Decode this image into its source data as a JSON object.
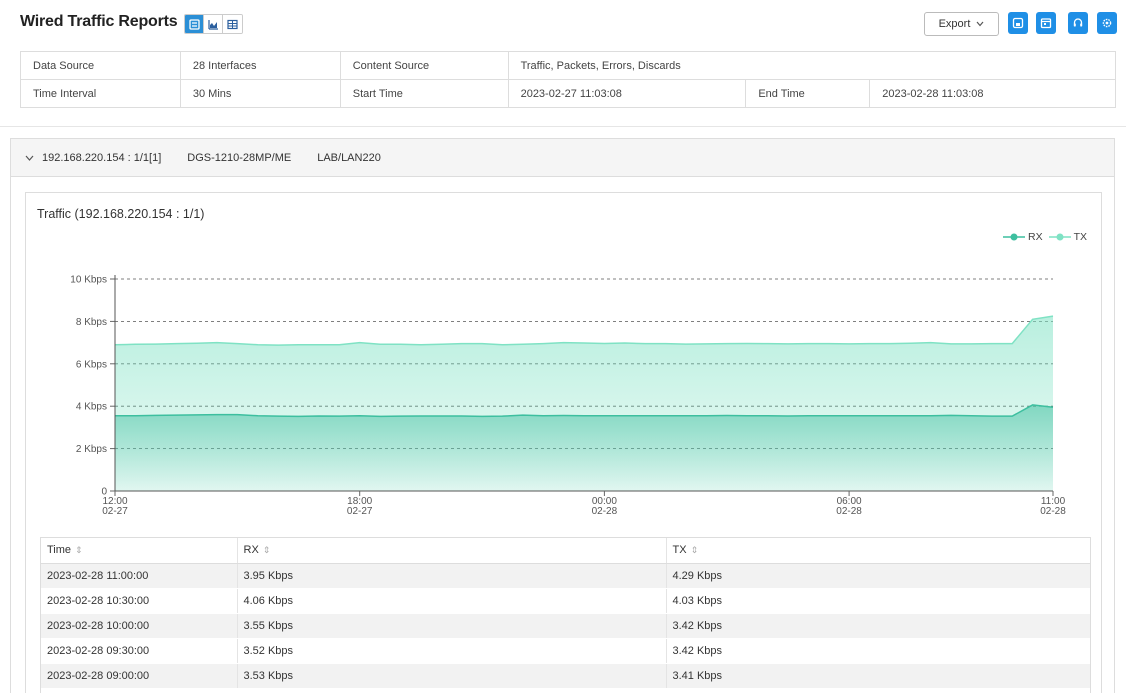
{
  "header": {
    "title": "Wired Traffic Reports",
    "export_label": "Export"
  },
  "info": {
    "row1": [
      {
        "label": "Data Source",
        "value": "28 Interfaces"
      },
      {
        "label": "Content Source",
        "value": "Traffic, Packets, Errors, Discards"
      }
    ],
    "row2": [
      {
        "label": "Time Interval",
        "value": "30 Mins"
      },
      {
        "label": "Start Time",
        "value": "2023-02-27 11:03:08"
      },
      {
        "label": "End Time",
        "value": "2023-02-28 11:03:08"
      }
    ]
  },
  "panel": {
    "ip_port": "192.168.220.154 : 1/1[1]",
    "model": "DGS-1210-28MP/ME",
    "location": "LAB/LAN220"
  },
  "chart_title": "Traffic (192.168.220.154 : 1/1)",
  "colors": {
    "rx": "#3dbf9f",
    "tx": "#7fe2c4",
    "accent": "#1f8fe6"
  },
  "chart_data": {
    "type": "area",
    "title": "Traffic (192.168.220.154 : 1/1)",
    "ylabel": "",
    "xlabel": "",
    "ylim": [
      0,
      10
    ],
    "y_unit": "Kbps",
    "y_ticks": [
      "0",
      "2 Kbps",
      "4 Kbps",
      "6 Kbps",
      "8 Kbps",
      "10 Kbps"
    ],
    "x_ticks": [
      {
        "time": "12:00",
        "date": "02-27"
      },
      {
        "time": "18:00",
        "date": "02-27"
      },
      {
        "time": "00:00",
        "date": "02-28"
      },
      {
        "time": "06:00",
        "date": "02-28"
      },
      {
        "time": "11:00",
        "date": "02-28"
      }
    ],
    "x_range_hours": [
      0,
      23
    ],
    "legend_position": "top-right",
    "grid": "horizontal dashed",
    "series": [
      {
        "name": "RX",
        "values": [
          3.55,
          3.55,
          3.57,
          3.58,
          3.59,
          3.6,
          3.6,
          3.55,
          3.53,
          3.52,
          3.54,
          3.53,
          3.55,
          3.52,
          3.53,
          3.54,
          3.54,
          3.54,
          3.52,
          3.53,
          3.58,
          3.55,
          3.56,
          3.55,
          3.55,
          3.55,
          3.55,
          3.55,
          3.55,
          3.55,
          3.56,
          3.55,
          3.55,
          3.54,
          3.55,
          3.55,
          3.55,
          3.55,
          3.55,
          3.55,
          3.55,
          3.57,
          3.55,
          3.53,
          3.53,
          4.06,
          3.95
        ]
      },
      {
        "name": "TX",
        "values": [
          6.9,
          6.92,
          6.93,
          6.95,
          6.97,
          7.0,
          6.95,
          6.9,
          6.88,
          6.9,
          6.9,
          6.9,
          7.0,
          6.92,
          6.92,
          6.9,
          6.92,
          6.95,
          6.95,
          6.9,
          6.92,
          6.95,
          7.0,
          6.98,
          6.96,
          6.98,
          6.95,
          6.95,
          6.93,
          6.94,
          6.95,
          6.96,
          6.95,
          6.94,
          6.95,
          6.95,
          6.94,
          6.95,
          6.95,
          6.97,
          7.0,
          6.94,
          6.94,
          6.95,
          6.95,
          8.1,
          8.25
        ]
      }
    ]
  },
  "table": {
    "headers": [
      "Time",
      "RX",
      "TX"
    ],
    "rows": [
      [
        "2023-02-28 11:00:00",
        "3.95 Kbps",
        "4.29 Kbps"
      ],
      [
        "2023-02-28 10:30:00",
        "4.06 Kbps",
        "4.03 Kbps"
      ],
      [
        "2023-02-28 10:00:00",
        "3.55 Kbps",
        "3.42 Kbps"
      ],
      [
        "2023-02-28 09:30:00",
        "3.52 Kbps",
        "3.42 Kbps"
      ],
      [
        "2023-02-28 09:00:00",
        "3.53 Kbps",
        "3.41 Kbps"
      ]
    ]
  }
}
